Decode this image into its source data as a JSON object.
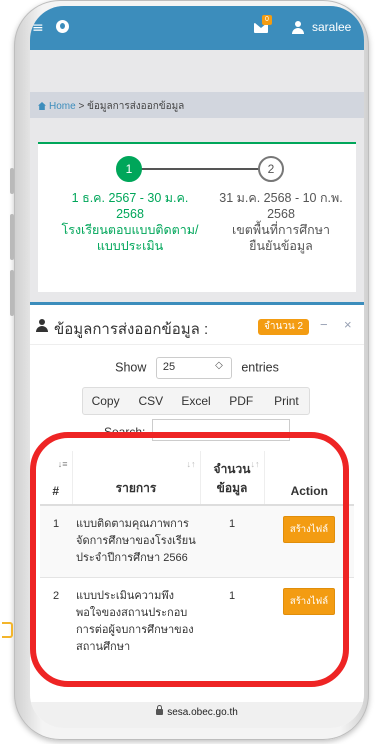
{
  "topbar": {
    "menu_glyph": "≡",
    "notification_count": "0",
    "username": "saralee",
    "brand_color": "#3c8dbc",
    "icons": [
      "menu-icon",
      "globe-icon",
      "mail-icon",
      "user-icon"
    ]
  },
  "breadcrumb": {
    "home": "Home",
    "separator": ">",
    "current": "ข้อมูลการส่งออกข้อมูล"
  },
  "stepper": {
    "steps": [
      {
        "number": "1",
        "date_line1": "1 ธ.ค. 2567 - 30 ม.ค.",
        "date_line2": "2568",
        "title_line1": "โรงเรียนตอบแบบติดตาม/",
        "title_line2": "แบบประเมิน",
        "active": true
      },
      {
        "number": "2",
        "date_line1": "31 ม.ค. 2568 - 10 ก.พ.",
        "date_line2": "2568",
        "title_line1": "เขตพื้นที่การศึกษา",
        "title_line2": "ยืนยันข้อมูล",
        "active": false
      }
    ],
    "active_color": "#00a65a"
  },
  "box": {
    "title": "ข้อมูลการส่งออกข้อมูล :",
    "count_badge": "จำนวน 2",
    "collapse_glyph": "−",
    "close_glyph": "×"
  },
  "datatable": {
    "show_label": "Show",
    "page_length": "25",
    "entries_label": "entries",
    "buttons": [
      "Copy",
      "CSV",
      "Excel",
      "PDF",
      "Print"
    ],
    "search_label": "Search:",
    "search_value": "",
    "columns": {
      "no": "#",
      "name": "รายการ",
      "count_line1": "จำนวน",
      "count_line2": "ข้อมูล",
      "action": "Action"
    },
    "rows": [
      {
        "no": "1",
        "name": "แบบติดตามคุณภาพการจัดการศึกษาของโรงเรียน ประจำปีการศึกษา 2566",
        "count": "1",
        "action": "สร้างไฟล์"
      },
      {
        "no": "2",
        "name": "แบบประเมินความพึงพอใจของสถานประกอบการต่อผู้จบการศึกษาของสถานศึกษา",
        "count": "1",
        "action": "สร้างไฟล์"
      }
    ]
  },
  "browser": {
    "url": "sesa.obec.go.th"
  },
  "annotation": {
    "highlight_color": "#ee2424"
  }
}
